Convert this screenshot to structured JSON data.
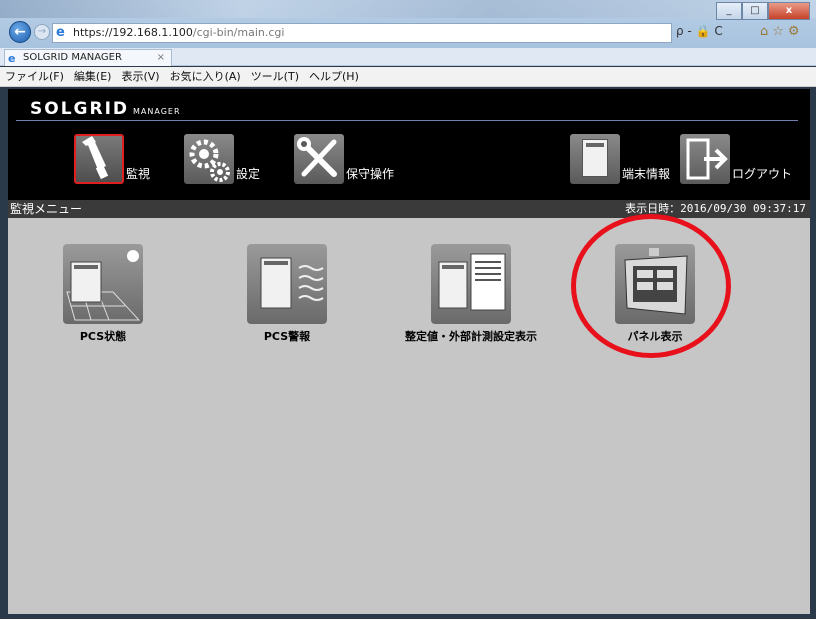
{
  "browser": {
    "url": "https://192.168.1.100/cgi-bin/main.cgi",
    "url_host": "https://192.168.1.100",
    "url_path": "/cgi-bin/main.cgi",
    "tab_title": "SOLGRID MANAGER",
    "tab_close": "×",
    "address_tools": "ρ - 🔒 C",
    "window_buttons": {
      "minimize": "_",
      "maximize": "□",
      "close": "x"
    },
    "menu": [
      "ファイル(F)",
      "編集(E)",
      "表示(V)",
      "お気に入り(A)",
      "ツール(T)",
      "ヘルプ(H)"
    ]
  },
  "app": {
    "logo_main": "SOLGRID",
    "logo_sub": "MANAGER",
    "nav": [
      {
        "label": "監視",
        "icon": "monitor-flashlight-icon",
        "active": true
      },
      {
        "label": "設定",
        "icon": "gears-icon",
        "active": false
      },
      {
        "label": "保守操作",
        "icon": "wrench-screwdriver-icon",
        "active": false
      },
      {
        "label": "端末情報",
        "icon": "terminal-cabinet-icon",
        "active": false
      },
      {
        "label": "ログアウト",
        "icon": "logout-door-icon",
        "active": false
      }
    ],
    "status": {
      "menu_title": "監視メニュー",
      "datetime": "表示日時：2016/09/30 09:37:17"
    },
    "tiles": [
      {
        "label": "PCS状態",
        "icon": "pcs-status-solar-icon"
      },
      {
        "label": "PCS警報",
        "icon": "pcs-alarm-icon"
      },
      {
        "label": "整定値・外部計測設定表示",
        "icon": "settings-values-document-icon"
      },
      {
        "label": "パネル表示",
        "icon": "panel-display-icon"
      }
    ],
    "accent_color": "#e8101a"
  }
}
